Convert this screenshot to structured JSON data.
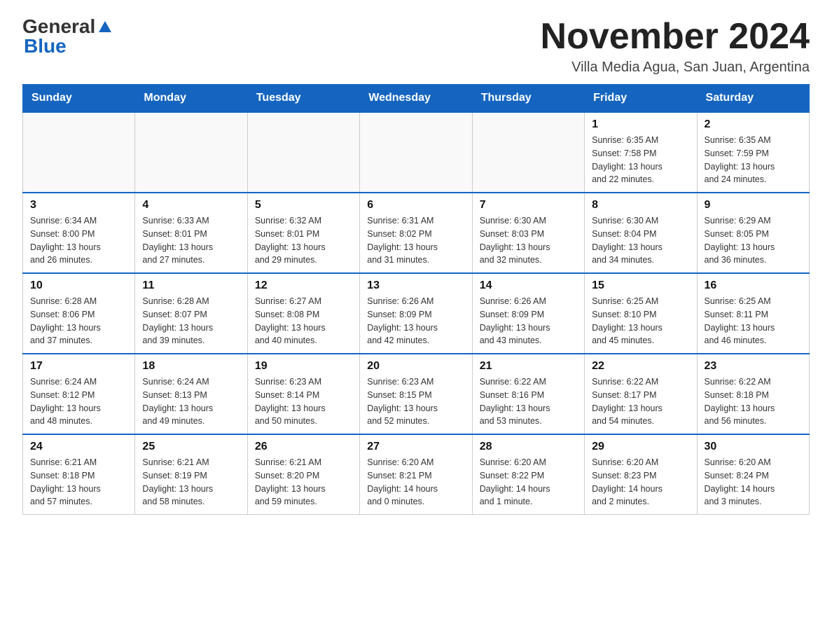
{
  "header": {
    "logo_general": "General",
    "logo_blue": "Blue",
    "title": "November 2024",
    "location": "Villa Media Agua, San Juan, Argentina"
  },
  "weekdays": [
    "Sunday",
    "Monday",
    "Tuesday",
    "Wednesday",
    "Thursday",
    "Friday",
    "Saturday"
  ],
  "weeks": [
    [
      {
        "day": "",
        "info": ""
      },
      {
        "day": "",
        "info": ""
      },
      {
        "day": "",
        "info": ""
      },
      {
        "day": "",
        "info": ""
      },
      {
        "day": "",
        "info": ""
      },
      {
        "day": "1",
        "info": "Sunrise: 6:35 AM\nSunset: 7:58 PM\nDaylight: 13 hours\nand 22 minutes."
      },
      {
        "day": "2",
        "info": "Sunrise: 6:35 AM\nSunset: 7:59 PM\nDaylight: 13 hours\nand 24 minutes."
      }
    ],
    [
      {
        "day": "3",
        "info": "Sunrise: 6:34 AM\nSunset: 8:00 PM\nDaylight: 13 hours\nand 26 minutes."
      },
      {
        "day": "4",
        "info": "Sunrise: 6:33 AM\nSunset: 8:01 PM\nDaylight: 13 hours\nand 27 minutes."
      },
      {
        "day": "5",
        "info": "Sunrise: 6:32 AM\nSunset: 8:01 PM\nDaylight: 13 hours\nand 29 minutes."
      },
      {
        "day": "6",
        "info": "Sunrise: 6:31 AM\nSunset: 8:02 PM\nDaylight: 13 hours\nand 31 minutes."
      },
      {
        "day": "7",
        "info": "Sunrise: 6:30 AM\nSunset: 8:03 PM\nDaylight: 13 hours\nand 32 minutes."
      },
      {
        "day": "8",
        "info": "Sunrise: 6:30 AM\nSunset: 8:04 PM\nDaylight: 13 hours\nand 34 minutes."
      },
      {
        "day": "9",
        "info": "Sunrise: 6:29 AM\nSunset: 8:05 PM\nDaylight: 13 hours\nand 36 minutes."
      }
    ],
    [
      {
        "day": "10",
        "info": "Sunrise: 6:28 AM\nSunset: 8:06 PM\nDaylight: 13 hours\nand 37 minutes."
      },
      {
        "day": "11",
        "info": "Sunrise: 6:28 AM\nSunset: 8:07 PM\nDaylight: 13 hours\nand 39 minutes."
      },
      {
        "day": "12",
        "info": "Sunrise: 6:27 AM\nSunset: 8:08 PM\nDaylight: 13 hours\nand 40 minutes."
      },
      {
        "day": "13",
        "info": "Sunrise: 6:26 AM\nSunset: 8:09 PM\nDaylight: 13 hours\nand 42 minutes."
      },
      {
        "day": "14",
        "info": "Sunrise: 6:26 AM\nSunset: 8:09 PM\nDaylight: 13 hours\nand 43 minutes."
      },
      {
        "day": "15",
        "info": "Sunrise: 6:25 AM\nSunset: 8:10 PM\nDaylight: 13 hours\nand 45 minutes."
      },
      {
        "day": "16",
        "info": "Sunrise: 6:25 AM\nSunset: 8:11 PM\nDaylight: 13 hours\nand 46 minutes."
      }
    ],
    [
      {
        "day": "17",
        "info": "Sunrise: 6:24 AM\nSunset: 8:12 PM\nDaylight: 13 hours\nand 48 minutes."
      },
      {
        "day": "18",
        "info": "Sunrise: 6:24 AM\nSunset: 8:13 PM\nDaylight: 13 hours\nand 49 minutes."
      },
      {
        "day": "19",
        "info": "Sunrise: 6:23 AM\nSunset: 8:14 PM\nDaylight: 13 hours\nand 50 minutes."
      },
      {
        "day": "20",
        "info": "Sunrise: 6:23 AM\nSunset: 8:15 PM\nDaylight: 13 hours\nand 52 minutes."
      },
      {
        "day": "21",
        "info": "Sunrise: 6:22 AM\nSunset: 8:16 PM\nDaylight: 13 hours\nand 53 minutes."
      },
      {
        "day": "22",
        "info": "Sunrise: 6:22 AM\nSunset: 8:17 PM\nDaylight: 13 hours\nand 54 minutes."
      },
      {
        "day": "23",
        "info": "Sunrise: 6:22 AM\nSunset: 8:18 PM\nDaylight: 13 hours\nand 56 minutes."
      }
    ],
    [
      {
        "day": "24",
        "info": "Sunrise: 6:21 AM\nSunset: 8:18 PM\nDaylight: 13 hours\nand 57 minutes."
      },
      {
        "day": "25",
        "info": "Sunrise: 6:21 AM\nSunset: 8:19 PM\nDaylight: 13 hours\nand 58 minutes."
      },
      {
        "day": "26",
        "info": "Sunrise: 6:21 AM\nSunset: 8:20 PM\nDaylight: 13 hours\nand 59 minutes."
      },
      {
        "day": "27",
        "info": "Sunrise: 6:20 AM\nSunset: 8:21 PM\nDaylight: 14 hours\nand 0 minutes."
      },
      {
        "day": "28",
        "info": "Sunrise: 6:20 AM\nSunset: 8:22 PM\nDaylight: 14 hours\nand 1 minute."
      },
      {
        "day": "29",
        "info": "Sunrise: 6:20 AM\nSunset: 8:23 PM\nDaylight: 14 hours\nand 2 minutes."
      },
      {
        "day": "30",
        "info": "Sunrise: 6:20 AM\nSunset: 8:24 PM\nDaylight: 14 hours\nand 3 minutes."
      }
    ]
  ]
}
